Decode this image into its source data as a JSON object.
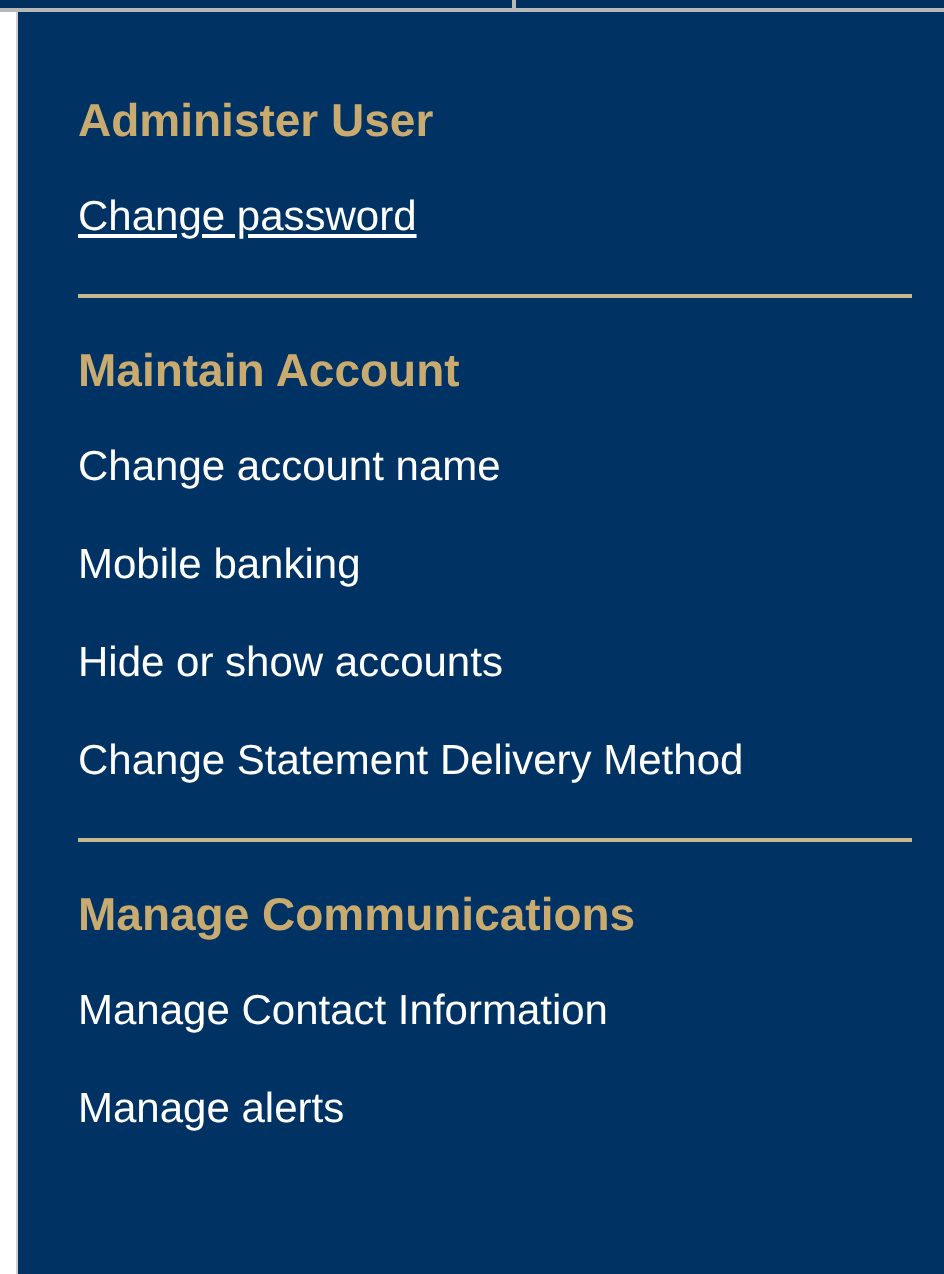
{
  "sections": [
    {
      "heading": "Administer User",
      "items": [
        {
          "label": "Change password",
          "selected": true
        }
      ]
    },
    {
      "heading": "Maintain Account",
      "items": [
        {
          "label": "Change account name",
          "selected": false
        },
        {
          "label": "Mobile banking",
          "selected": false
        },
        {
          "label": "Hide or show accounts",
          "selected": false
        },
        {
          "label": "Change Statement Delivery Method",
          "selected": false
        }
      ]
    },
    {
      "heading": "Manage Communications",
      "items": [
        {
          "label": "Manage Contact Information",
          "selected": false
        },
        {
          "label": "Manage alerts",
          "selected": false
        }
      ]
    }
  ]
}
